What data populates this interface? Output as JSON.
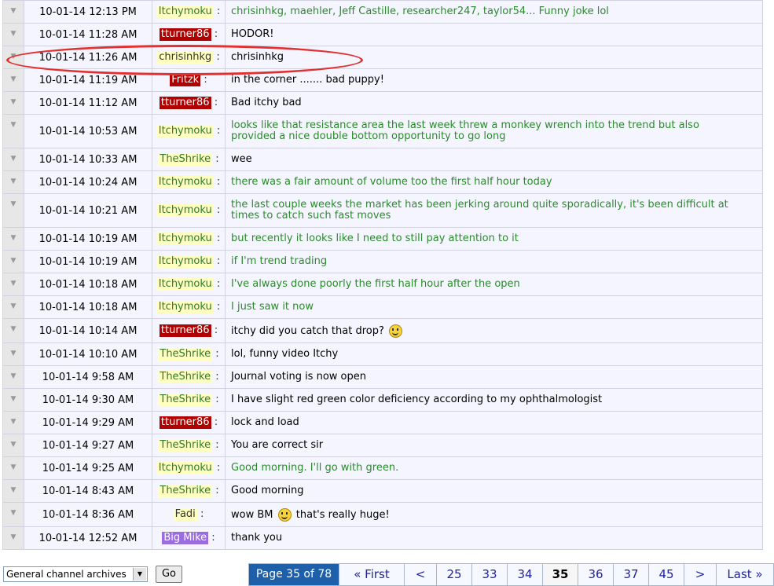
{
  "messages": [
    {
      "time": "10-01-14 12:13 PM",
      "user": "Itchymoku",
      "style": "itchy",
      "text": "chrisinhkg, maehler, Jeff Castille, researcher247, taylor54... Funny joke lol",
      "green": true
    },
    {
      "time": "10-01-14 11:28 AM",
      "user": "tturner86",
      "style": "tturner",
      "text": "HODOR!",
      "green": false
    },
    {
      "time": "10-01-14 11:26 AM",
      "user": "chrisinhkg",
      "style": "plain",
      "text": "chrisinhkg",
      "green": false
    },
    {
      "time": "10-01-14 11:19 AM",
      "user": "Fritzk",
      "style": "tturner",
      "text": "in the corner ....... bad puppy!",
      "green": false
    },
    {
      "time": "10-01-14 11:12 AM",
      "user": "tturner86",
      "style": "tturner",
      "text": "Bad itchy bad",
      "green": false
    },
    {
      "time": "10-01-14 10:53 AM",
      "user": "Itchymoku",
      "style": "itchy",
      "text": "looks like that resistance area the last week threw a monkey wrench into the trend but also provided a nice double bottom opportunity to go long",
      "green": true
    },
    {
      "time": "10-01-14 10:33 AM",
      "user": "TheShrike",
      "style": "shrike",
      "text": "wee",
      "green": false
    },
    {
      "time": "10-01-14 10:24 AM",
      "user": "Itchymoku",
      "style": "itchy",
      "text": "there was a fair amount of volume too the first half hour today",
      "green": true
    },
    {
      "time": "10-01-14 10:21 AM",
      "user": "Itchymoku",
      "style": "itchy",
      "text": "the last couple weeks the market has been jerking around quite sporadically, it's been difficult at times to catch such fast moves",
      "green": true
    },
    {
      "time": "10-01-14 10:19 AM",
      "user": "Itchymoku",
      "style": "itchy",
      "text": "but recently it looks like I need to still pay attention to it",
      "green": true
    },
    {
      "time": "10-01-14 10:19 AM",
      "user": "Itchymoku",
      "style": "itchy",
      "text": "if I'm trend trading",
      "green": true
    },
    {
      "time": "10-01-14 10:18 AM",
      "user": "Itchymoku",
      "style": "itchy",
      "text": "I've always done poorly the first half hour after the open",
      "green": true
    },
    {
      "time": "10-01-14 10:18 AM",
      "user": "Itchymoku",
      "style": "itchy",
      "text": "I just saw it now",
      "green": true
    },
    {
      "time": "10-01-14 10:14 AM",
      "user": "tturner86",
      "style": "tturner",
      "text": "itchy did you catch that drop?",
      "smiley": "after",
      "green": false
    },
    {
      "time": "10-01-14 10:10 AM",
      "user": "TheShrike",
      "style": "shrike",
      "text": "lol, funny video Itchy",
      "green": false
    },
    {
      "time": "10-01-14 9:58 AM",
      "user": "TheShrike",
      "style": "shrike",
      "text": "Journal voting is now open",
      "green": false
    },
    {
      "time": "10-01-14 9:30 AM",
      "user": "TheShrike",
      "style": "shrike",
      "text": "I have slight red green color deficiency according to my ophthalmologist",
      "green": false
    },
    {
      "time": "10-01-14 9:29 AM",
      "user": "tturner86",
      "style": "tturner",
      "text": "lock and load",
      "green": false
    },
    {
      "time": "10-01-14 9:27 AM",
      "user": "TheShrike",
      "style": "shrike",
      "text": "You are correct sir",
      "green": false
    },
    {
      "time": "10-01-14 9:25 AM",
      "user": "Itchymoku",
      "style": "itchy",
      "text": "Good morning. I'll go with green.",
      "green": true
    },
    {
      "time": "10-01-14 8:43 AM",
      "user": "TheShrike",
      "style": "shrike",
      "text": "Good morning",
      "green": false
    },
    {
      "time": "10-01-14 8:36 AM",
      "user": "Fadi",
      "style": "plain",
      "text_before": "wow BM",
      "text_after": "that's really huge!",
      "smiley": "middle",
      "green": false
    },
    {
      "time": "10-01-14 12:52 AM",
      "user": "Big Mike",
      "style": "bigmike",
      "text": "thank you",
      "green": false
    }
  ],
  "row_tall": [
    5,
    8
  ],
  "colon": ":",
  "archive_select": {
    "value": "General channel archives"
  },
  "go_label": "Go",
  "pager": {
    "label": "Page 35 of 78",
    "first": "« First",
    "prev": "<",
    "pages": [
      "25",
      "33",
      "34",
      "35",
      "36",
      "37",
      "45"
    ],
    "current": "35",
    "next": ">",
    "last": "Last »"
  },
  "colors": {
    "username_green": "#2f7a2f",
    "tturner_red": "#b00000",
    "message_green": "#2b8a2b",
    "pager_blue": "#1d5fa8",
    "highlight_red": "#e23030"
  }
}
